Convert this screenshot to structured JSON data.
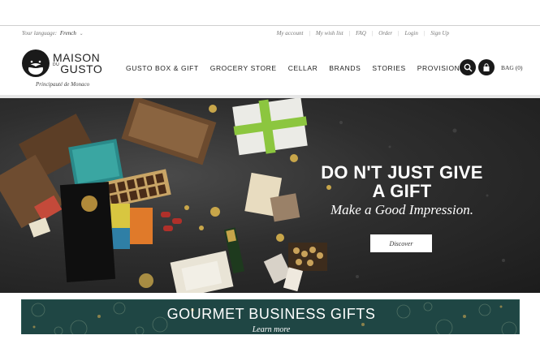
{
  "utility": {
    "language_label": "Your language:",
    "language_value": "French",
    "links": [
      "My account",
      "My wish list",
      "FAQ",
      "Order",
      "Login",
      "Sign Up"
    ]
  },
  "logo": {
    "word1": "MAISON",
    "word2_prefix": "DU",
    "word2": "GUSTO",
    "tagline": "Principauté de Monaco"
  },
  "nav": [
    "GUSTO BOX & GIFT",
    "GROCERY STORE",
    "CELLAR",
    "BRANDS",
    "STORIES",
    "PROVISIONING"
  ],
  "tools": {
    "search_icon": "search-icon",
    "bag_icon": "bag-icon",
    "bag_label": "BAG (0)"
  },
  "hero": {
    "headline_line1": "DO N'T JUST GIVE",
    "headline_line2": "A GIFT",
    "subheadline": "Make a Good Impression.",
    "button": "Discover"
  },
  "banner": {
    "title": "GOURMET BUSINESS GIFTS",
    "subtitle": "Learn more"
  },
  "colors": {
    "banner_green": "#1f4644",
    "hero_dark": "#2e2e2e",
    "text_dark": "#222222"
  }
}
